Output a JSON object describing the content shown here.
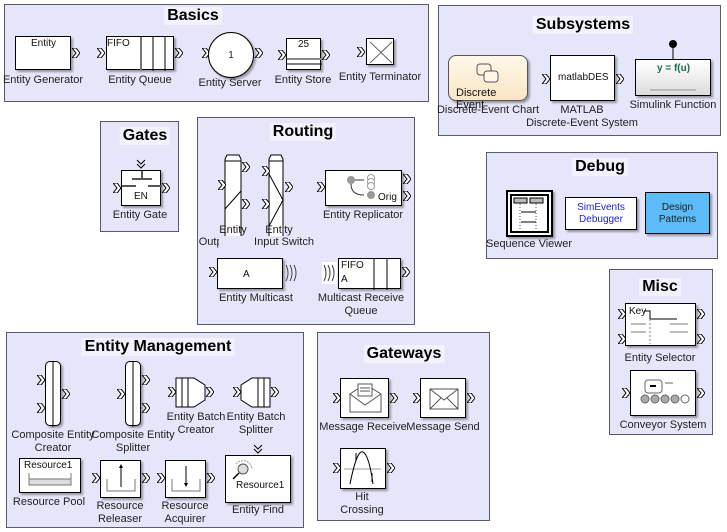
{
  "colors": {
    "panel": "#e6e6fa",
    "design_patterns": "#5bbcf9",
    "debugger_text": "#1a1adc",
    "chart_fill": "#fdf0d8"
  },
  "basics": {
    "title": "Basics",
    "gen_label": "Entity Generator",
    "gen_text": "Entity",
    "queue_label": "Entity Queue",
    "queue_text": "FIFO",
    "server_label": "Entity Server",
    "server_text": "1",
    "store_label": "Entity Store",
    "store_text": "25",
    "term_label": "Entity Terminator"
  },
  "subsystems": {
    "title": "Subsystems",
    "chart_label": "Discrete-Event Chart",
    "chart_text": "Discrete Event",
    "mdes_label1": "MATLAB",
    "mdes_label2": "Discrete-Event System",
    "mdes_text": "matlabDES",
    "func_label": "Simulink Function",
    "func_text": "y = f(u)"
  },
  "gates": {
    "title": "Gates",
    "gate_label": "Entity Gate",
    "gate_text": "EN"
  },
  "routing": {
    "title": "Routing",
    "out_label1": "Entity",
    "out_label2": "Output Switch",
    "in_label1": "Entity",
    "in_label2": "Input Switch",
    "rep_label": "Entity Replicator",
    "rep_text": "Orig",
    "mc_label": "Entity Multicast",
    "mc_text": "A",
    "mrq_label1": "Multicast Receive",
    "mrq_label2": "Queue",
    "mrq_text1": "FIFO",
    "mrq_text2": "A"
  },
  "debug": {
    "title": "Debug",
    "seq_label": "Sequence Viewer",
    "dbg_text1": "SimEvents",
    "dbg_text2": "Debugger",
    "dp_text1": "Design",
    "dp_text2": "Patterns"
  },
  "misc": {
    "title": "Misc",
    "sel_label": "Entity Selector",
    "sel_text": "Key",
    "conv_label": "Conveyor System"
  },
  "management": {
    "title": "Entity Management",
    "cc_label1": "Composite Entity",
    "cc_label2": "Creator",
    "cs_label1": "Composite Entity",
    "cs_label2": "Splitter",
    "bc_label1": "Entity Batch",
    "bc_label2": "Creator",
    "bs_label1": "Entity Batch",
    "bs_label2": "Splitter",
    "pool_label": "Resource Pool",
    "pool_text": "Resource1",
    "rel_label1": "Resource",
    "rel_label2": "Releaser",
    "acq_label1": "Resource",
    "acq_label2": "Acquirer",
    "find_label": "Entity Find",
    "find_text": "Resource1"
  },
  "gateways": {
    "title": "Gateways",
    "recv_label": "Message Receive",
    "send_label": "Message Send",
    "hit_label1": "Hit",
    "hit_label2": "Crossing"
  }
}
